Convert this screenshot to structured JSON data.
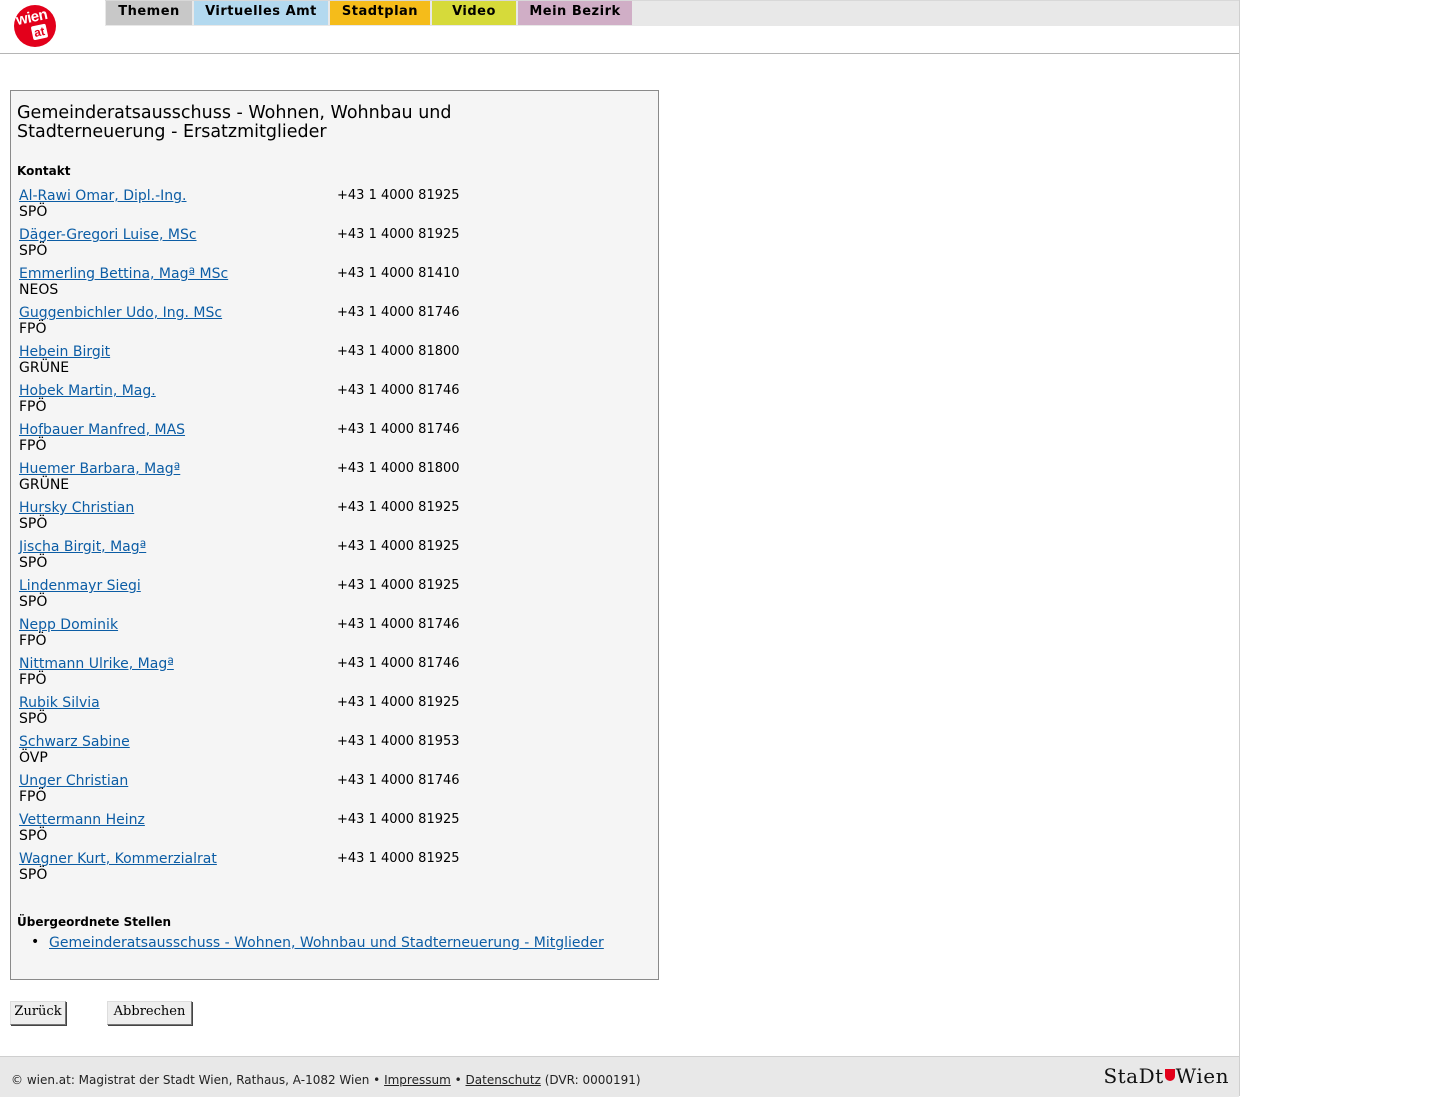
{
  "logo": {
    "text_top": "wien",
    "text_bottom": "at"
  },
  "nav": {
    "tabs": [
      {
        "label": "Themen",
        "color": "#c8c8c8"
      },
      {
        "label": "Virtuelles Amt",
        "color": "#b3d9ef"
      },
      {
        "label": "Stadtplan",
        "color": "#f5bc1a"
      },
      {
        "label": "Video",
        "color": "#d6da3a"
      },
      {
        "label": "Mein Bezirk",
        "color": "#d0aec6"
      }
    ]
  },
  "main": {
    "title": "Gemeinderatsausschuss - Wohnen, Wohnbau und Stadterneuerung - Ersatzmitglieder",
    "kontakt_label": "Kontakt",
    "contacts": [
      {
        "name": "Al-Rawi Omar, Dipl.-Ing.",
        "party": "SPÖ",
        "phone": "+43 1 4000 81925"
      },
      {
        "name": "Däger-Gregori Luise, MSc",
        "party": "SPÖ",
        "phone": "+43 1 4000 81925"
      },
      {
        "name": "Emmerling Bettina, Magª MSc",
        "party": "NEOS",
        "phone": "+43 1 4000 81410"
      },
      {
        "name": "Guggenbichler Udo, Ing. MSc",
        "party": "FPÖ",
        "phone": "+43 1 4000 81746"
      },
      {
        "name": "Hebein Birgit",
        "party": "GRÜNE",
        "phone": "+43 1 4000 81800"
      },
      {
        "name": "Hobek Martin, Mag.",
        "party": "FPÖ",
        "phone": "+43 1 4000 81746"
      },
      {
        "name": "Hofbauer Manfred, MAS",
        "party": "FPÖ",
        "phone": "+43 1 4000 81746"
      },
      {
        "name": "Huemer Barbara, Magª",
        "party": "GRÜNE",
        "phone": "+43 1 4000 81800"
      },
      {
        "name": "Hursky Christian",
        "party": "SPÖ",
        "phone": "+43 1 4000 81925"
      },
      {
        "name": "Jischa Birgit, Magª",
        "party": "SPÖ",
        "phone": "+43 1 4000 81925"
      },
      {
        "name": "Lindenmayr Siegi",
        "party": "SPÖ",
        "phone": "+43 1 4000 81925"
      },
      {
        "name": "Nepp Dominik",
        "party": "FPÖ",
        "phone": "+43 1 4000 81746"
      },
      {
        "name": "Nittmann Ulrike, Magª",
        "party": "FPÖ",
        "phone": "+43 1 4000 81746"
      },
      {
        "name": "Rubik Silvia",
        "party": "SPÖ",
        "phone": "+43 1 4000 81925"
      },
      {
        "name": "Schwarz Sabine",
        "party": "ÖVP",
        "phone": "+43 1 4000 81953"
      },
      {
        "name": "Unger Christian",
        "party": "FPÖ",
        "phone": "+43 1 4000 81746"
      },
      {
        "name": "Vettermann Heinz",
        "party": "SPÖ",
        "phone": "+43 1 4000 81925"
      },
      {
        "name": "Wagner Kurt, Kommerzialrat",
        "party": "SPÖ",
        "phone": "+43 1 4000 81925"
      }
    ],
    "parent_label": "Übergeordnete Stellen",
    "parent_links": [
      "Gemeinderatsausschuss - Wohnen, Wohnbau und Stadterneuerung - Mitglieder"
    ]
  },
  "buttons": {
    "back": "Zurück",
    "cancel": "Abbrechen"
  },
  "footer": {
    "prefix": "© wien.at: Magistrat der Stadt Wien, Rathaus, A-1082 Wien •",
    "impressum": "Impressum",
    "separator": "•",
    "datenschutz": "Datenschutz",
    "dvr": "(DVR: 0000191)",
    "brand_left": "StaDt",
    "brand_right": "Wien"
  },
  "colors": {
    "link": "#0c5da5",
    "logo_red": "#e3001b",
    "box_bg": "#f5f5f5"
  }
}
